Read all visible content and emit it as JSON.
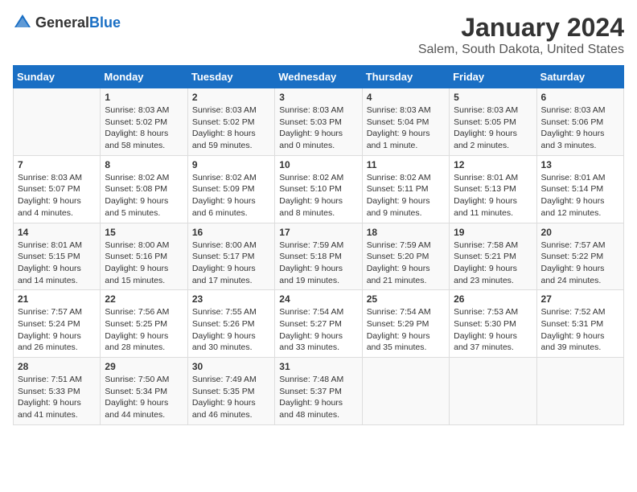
{
  "header": {
    "logo_general": "General",
    "logo_blue": "Blue",
    "title": "January 2024",
    "subtitle": "Salem, South Dakota, United States"
  },
  "columns": [
    "Sunday",
    "Monday",
    "Tuesday",
    "Wednesday",
    "Thursday",
    "Friday",
    "Saturday"
  ],
  "weeks": [
    [
      {
        "day": "",
        "info": ""
      },
      {
        "day": "1",
        "info": "Sunrise: 8:03 AM\nSunset: 5:02 PM\nDaylight: 8 hours\nand 58 minutes."
      },
      {
        "day": "2",
        "info": "Sunrise: 8:03 AM\nSunset: 5:02 PM\nDaylight: 8 hours\nand 59 minutes."
      },
      {
        "day": "3",
        "info": "Sunrise: 8:03 AM\nSunset: 5:03 PM\nDaylight: 9 hours\nand 0 minutes."
      },
      {
        "day": "4",
        "info": "Sunrise: 8:03 AM\nSunset: 5:04 PM\nDaylight: 9 hours\nand 1 minute."
      },
      {
        "day": "5",
        "info": "Sunrise: 8:03 AM\nSunset: 5:05 PM\nDaylight: 9 hours\nand 2 minutes."
      },
      {
        "day": "6",
        "info": "Sunrise: 8:03 AM\nSunset: 5:06 PM\nDaylight: 9 hours\nand 3 minutes."
      }
    ],
    [
      {
        "day": "7",
        "info": "Sunrise: 8:03 AM\nSunset: 5:07 PM\nDaylight: 9 hours\nand 4 minutes."
      },
      {
        "day": "8",
        "info": "Sunrise: 8:02 AM\nSunset: 5:08 PM\nDaylight: 9 hours\nand 5 minutes."
      },
      {
        "day": "9",
        "info": "Sunrise: 8:02 AM\nSunset: 5:09 PM\nDaylight: 9 hours\nand 6 minutes."
      },
      {
        "day": "10",
        "info": "Sunrise: 8:02 AM\nSunset: 5:10 PM\nDaylight: 9 hours\nand 8 minutes."
      },
      {
        "day": "11",
        "info": "Sunrise: 8:02 AM\nSunset: 5:11 PM\nDaylight: 9 hours\nand 9 minutes."
      },
      {
        "day": "12",
        "info": "Sunrise: 8:01 AM\nSunset: 5:13 PM\nDaylight: 9 hours\nand 11 minutes."
      },
      {
        "day": "13",
        "info": "Sunrise: 8:01 AM\nSunset: 5:14 PM\nDaylight: 9 hours\nand 12 minutes."
      }
    ],
    [
      {
        "day": "14",
        "info": "Sunrise: 8:01 AM\nSunset: 5:15 PM\nDaylight: 9 hours\nand 14 minutes."
      },
      {
        "day": "15",
        "info": "Sunrise: 8:00 AM\nSunset: 5:16 PM\nDaylight: 9 hours\nand 15 minutes."
      },
      {
        "day": "16",
        "info": "Sunrise: 8:00 AM\nSunset: 5:17 PM\nDaylight: 9 hours\nand 17 minutes."
      },
      {
        "day": "17",
        "info": "Sunrise: 7:59 AM\nSunset: 5:18 PM\nDaylight: 9 hours\nand 19 minutes."
      },
      {
        "day": "18",
        "info": "Sunrise: 7:59 AM\nSunset: 5:20 PM\nDaylight: 9 hours\nand 21 minutes."
      },
      {
        "day": "19",
        "info": "Sunrise: 7:58 AM\nSunset: 5:21 PM\nDaylight: 9 hours\nand 23 minutes."
      },
      {
        "day": "20",
        "info": "Sunrise: 7:57 AM\nSunset: 5:22 PM\nDaylight: 9 hours\nand 24 minutes."
      }
    ],
    [
      {
        "day": "21",
        "info": "Sunrise: 7:57 AM\nSunset: 5:24 PM\nDaylight: 9 hours\nand 26 minutes."
      },
      {
        "day": "22",
        "info": "Sunrise: 7:56 AM\nSunset: 5:25 PM\nDaylight: 9 hours\nand 28 minutes."
      },
      {
        "day": "23",
        "info": "Sunrise: 7:55 AM\nSunset: 5:26 PM\nDaylight: 9 hours\nand 30 minutes."
      },
      {
        "day": "24",
        "info": "Sunrise: 7:54 AM\nSunset: 5:27 PM\nDaylight: 9 hours\nand 33 minutes."
      },
      {
        "day": "25",
        "info": "Sunrise: 7:54 AM\nSunset: 5:29 PM\nDaylight: 9 hours\nand 35 minutes."
      },
      {
        "day": "26",
        "info": "Sunrise: 7:53 AM\nSunset: 5:30 PM\nDaylight: 9 hours\nand 37 minutes."
      },
      {
        "day": "27",
        "info": "Sunrise: 7:52 AM\nSunset: 5:31 PM\nDaylight: 9 hours\nand 39 minutes."
      }
    ],
    [
      {
        "day": "28",
        "info": "Sunrise: 7:51 AM\nSunset: 5:33 PM\nDaylight: 9 hours\nand 41 minutes."
      },
      {
        "day": "29",
        "info": "Sunrise: 7:50 AM\nSunset: 5:34 PM\nDaylight: 9 hours\nand 44 minutes."
      },
      {
        "day": "30",
        "info": "Sunrise: 7:49 AM\nSunset: 5:35 PM\nDaylight: 9 hours\nand 46 minutes."
      },
      {
        "day": "31",
        "info": "Sunrise: 7:48 AM\nSunset: 5:37 PM\nDaylight: 9 hours\nand 48 minutes."
      },
      {
        "day": "",
        "info": ""
      },
      {
        "day": "",
        "info": ""
      },
      {
        "day": "",
        "info": ""
      }
    ]
  ]
}
